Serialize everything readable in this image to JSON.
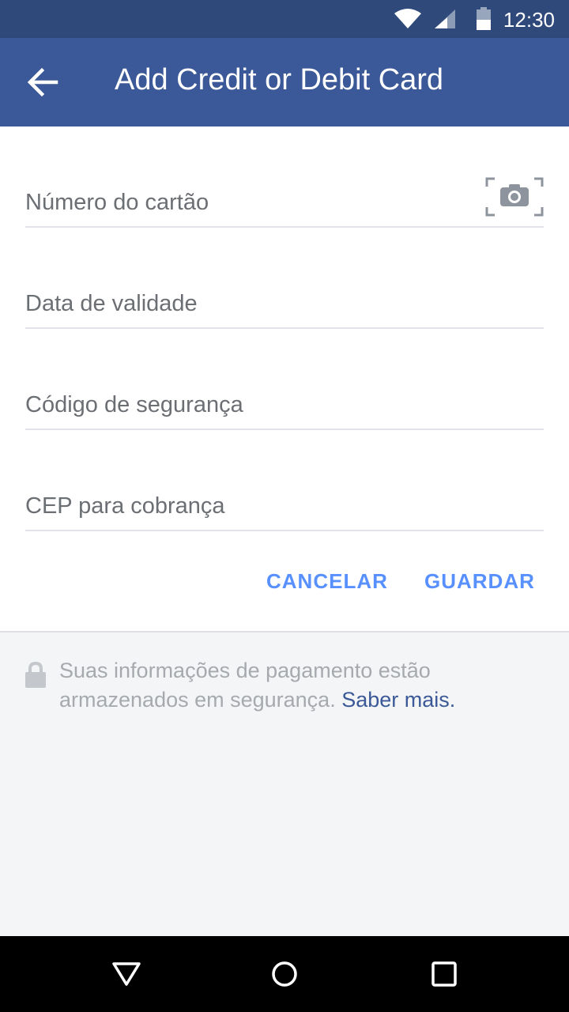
{
  "status_bar": {
    "time": "12:30",
    "icons": [
      "wifi-icon",
      "signal-icon",
      "battery-icon"
    ],
    "background_color": "#2f4a7a"
  },
  "app_bar": {
    "title": "Add Credit or Debit Card",
    "back_icon": "arrow-left-icon",
    "background_color": "#3b5998"
  },
  "form": {
    "card_number": {
      "placeholder": "Número do cartão",
      "value": ""
    },
    "camera_icon": "camera-scan-icon",
    "expiry_date": {
      "placeholder": "Data de validade",
      "value": ""
    },
    "security_code": {
      "placeholder": "Código de segurança",
      "value": ""
    },
    "billing_zip": {
      "placeholder": "CEP para cobrança",
      "value": ""
    }
  },
  "actions": {
    "cancel_label": "CANCELAR",
    "save_label": "GUARDAR",
    "accent_color": "#5890ff"
  },
  "footer": {
    "lock_icon": "lock-icon",
    "note_text": "Suas informações de pagamento estão armazenados em segurança.",
    "learn_more_label": "Saber mais.",
    "link_color": "#3b5998"
  },
  "nav_bar": {
    "icons": [
      "back-triangle-icon",
      "home-circle-icon",
      "recents-square-icon"
    ]
  }
}
